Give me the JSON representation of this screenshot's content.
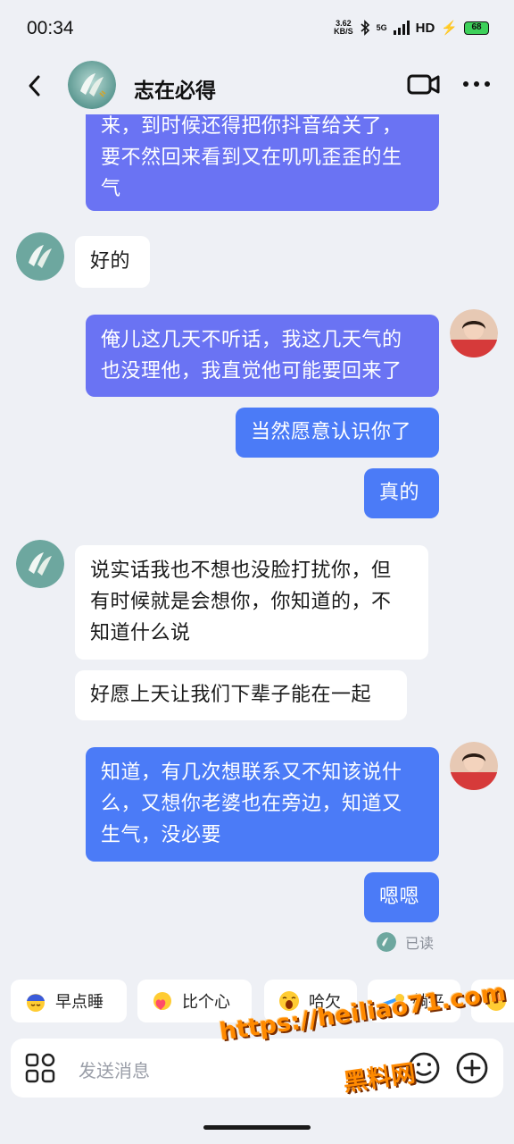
{
  "status_bar": {
    "time": "00:34",
    "net_speed_top": "3.62",
    "net_speed_bottom": "KB/S",
    "network": "5G",
    "hd": "HD",
    "battery": "68"
  },
  "header": {
    "contact_name": "志在必得"
  },
  "messages": {
    "m1": "来，到时候还得把你抖音给关了，\n要不然回来看到又在叽叽歪歪的生\n气",
    "m2": "好的",
    "m3": "俺儿这几天不听话，我这几天气的\n也没理他，我直觉他可能要回来了",
    "m4": "当然愿意认识你了",
    "m5": "真的",
    "m6": "说实话我也不想也没脸打扰你，但\n有时候就是会想你，你知道的，不\n知道什么说",
    "m7": "好愿上天让我们下辈子能在一起",
    "m8": "知道，有几次想联系又不知该说什\n么，又想你老婆也在旁边，知道又\n生气，没必要",
    "m9": "嗯嗯",
    "read_status": "已读"
  },
  "quick_replies": [
    "早点睡",
    "比个心",
    "哈欠",
    "躺平"
  ],
  "input": {
    "placeholder": "发送消息"
  },
  "watermark": {
    "url": "https://heiliao71.com",
    "text": "黑料网"
  },
  "colors": {
    "outgoing_bubble": "#4b7bf7",
    "outgoing_bubble_alt": "#6a73f3",
    "incoming_bubble": "#ffffff",
    "background": "#eef0f5",
    "watermark": "#ff8a00"
  },
  "icons": [
    "back-icon",
    "video-call-icon",
    "more-icon",
    "apps-grid-icon",
    "emoji-icon",
    "plus-icon",
    "bluetooth-icon",
    "signal-icon",
    "battery-icon"
  ]
}
